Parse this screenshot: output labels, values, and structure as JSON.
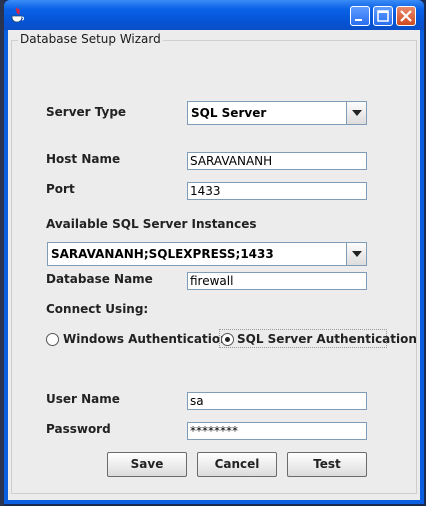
{
  "window": {
    "title": ""
  },
  "group": {
    "legend": "Database Setup Wizard"
  },
  "server_type": {
    "label": "Server Type",
    "value": "SQL Server"
  },
  "host": {
    "label": "Host Name",
    "value": "SARAVANANH"
  },
  "port": {
    "label": "Port",
    "value": "1433"
  },
  "instances": {
    "label": "Available SQL Server Instances",
    "value": "SARAVANANH;SQLEXPRESS;1433"
  },
  "database": {
    "label": "Database Name",
    "value": "firewall"
  },
  "connect_using": {
    "label": "Connect Using:"
  },
  "auth": {
    "windows_label": "Windows Authentication",
    "sql_label": "SQL Server Authentication",
    "selected": "sql"
  },
  "user": {
    "label": "User Name",
    "value": "sa"
  },
  "password": {
    "label": "Password",
    "value": "********"
  },
  "buttons": {
    "save": "Save",
    "cancel": "Cancel",
    "test": "Test"
  }
}
